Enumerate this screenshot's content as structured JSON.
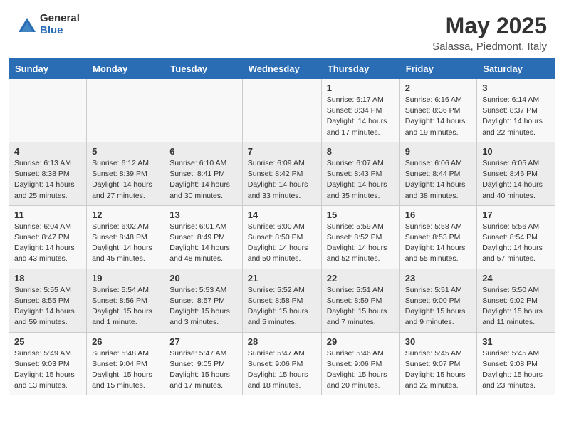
{
  "header": {
    "logo_general": "General",
    "logo_blue": "Blue",
    "month": "May 2025",
    "location": "Salassa, Piedmont, Italy"
  },
  "weekdays": [
    "Sunday",
    "Monday",
    "Tuesday",
    "Wednesday",
    "Thursday",
    "Friday",
    "Saturday"
  ],
  "weeks": [
    [
      null,
      null,
      null,
      null,
      {
        "day": "1",
        "sunrise": "6:17 AM",
        "sunset": "8:34 PM",
        "daylight": "14 hours and 17 minutes."
      },
      {
        "day": "2",
        "sunrise": "6:16 AM",
        "sunset": "8:36 PM",
        "daylight": "14 hours and 19 minutes."
      },
      {
        "day": "3",
        "sunrise": "6:14 AM",
        "sunset": "8:37 PM",
        "daylight": "14 hours and 22 minutes."
      }
    ],
    [
      {
        "day": "4",
        "sunrise": "6:13 AM",
        "sunset": "8:38 PM",
        "daylight": "14 hours and 25 minutes."
      },
      {
        "day": "5",
        "sunrise": "6:12 AM",
        "sunset": "8:39 PM",
        "daylight": "14 hours and 27 minutes."
      },
      {
        "day": "6",
        "sunrise": "6:10 AM",
        "sunset": "8:41 PM",
        "daylight": "14 hours and 30 minutes."
      },
      {
        "day": "7",
        "sunrise": "6:09 AM",
        "sunset": "8:42 PM",
        "daylight": "14 hours and 33 minutes."
      },
      {
        "day": "8",
        "sunrise": "6:07 AM",
        "sunset": "8:43 PM",
        "daylight": "14 hours and 35 minutes."
      },
      {
        "day": "9",
        "sunrise": "6:06 AM",
        "sunset": "8:44 PM",
        "daylight": "14 hours and 38 minutes."
      },
      {
        "day": "10",
        "sunrise": "6:05 AM",
        "sunset": "8:46 PM",
        "daylight": "14 hours and 40 minutes."
      }
    ],
    [
      {
        "day": "11",
        "sunrise": "6:04 AM",
        "sunset": "8:47 PM",
        "daylight": "14 hours and 43 minutes."
      },
      {
        "day": "12",
        "sunrise": "6:02 AM",
        "sunset": "8:48 PM",
        "daylight": "14 hours and 45 minutes."
      },
      {
        "day": "13",
        "sunrise": "6:01 AM",
        "sunset": "8:49 PM",
        "daylight": "14 hours and 48 minutes."
      },
      {
        "day": "14",
        "sunrise": "6:00 AM",
        "sunset": "8:50 PM",
        "daylight": "14 hours and 50 minutes."
      },
      {
        "day": "15",
        "sunrise": "5:59 AM",
        "sunset": "8:52 PM",
        "daylight": "14 hours and 52 minutes."
      },
      {
        "day": "16",
        "sunrise": "5:58 AM",
        "sunset": "8:53 PM",
        "daylight": "14 hours and 55 minutes."
      },
      {
        "day": "17",
        "sunrise": "5:56 AM",
        "sunset": "8:54 PM",
        "daylight": "14 hours and 57 minutes."
      }
    ],
    [
      {
        "day": "18",
        "sunrise": "5:55 AM",
        "sunset": "8:55 PM",
        "daylight": "14 hours and 59 minutes."
      },
      {
        "day": "19",
        "sunrise": "5:54 AM",
        "sunset": "8:56 PM",
        "daylight": "15 hours and 1 minute."
      },
      {
        "day": "20",
        "sunrise": "5:53 AM",
        "sunset": "8:57 PM",
        "daylight": "15 hours and 3 minutes."
      },
      {
        "day": "21",
        "sunrise": "5:52 AM",
        "sunset": "8:58 PM",
        "daylight": "15 hours and 5 minutes."
      },
      {
        "day": "22",
        "sunrise": "5:51 AM",
        "sunset": "8:59 PM",
        "daylight": "15 hours and 7 minutes."
      },
      {
        "day": "23",
        "sunrise": "5:51 AM",
        "sunset": "9:00 PM",
        "daylight": "15 hours and 9 minutes."
      },
      {
        "day": "24",
        "sunrise": "5:50 AM",
        "sunset": "9:02 PM",
        "daylight": "15 hours and 11 minutes."
      }
    ],
    [
      {
        "day": "25",
        "sunrise": "5:49 AM",
        "sunset": "9:03 PM",
        "daylight": "15 hours and 13 minutes."
      },
      {
        "day": "26",
        "sunrise": "5:48 AM",
        "sunset": "9:04 PM",
        "daylight": "15 hours and 15 minutes."
      },
      {
        "day": "27",
        "sunrise": "5:47 AM",
        "sunset": "9:05 PM",
        "daylight": "15 hours and 17 minutes."
      },
      {
        "day": "28",
        "sunrise": "5:47 AM",
        "sunset": "9:06 PM",
        "daylight": "15 hours and 18 minutes."
      },
      {
        "day": "29",
        "sunrise": "5:46 AM",
        "sunset": "9:06 PM",
        "daylight": "15 hours and 20 minutes."
      },
      {
        "day": "30",
        "sunrise": "5:45 AM",
        "sunset": "9:07 PM",
        "daylight": "15 hours and 22 minutes."
      },
      {
        "day": "31",
        "sunrise": "5:45 AM",
        "sunset": "9:08 PM",
        "daylight": "15 hours and 23 minutes."
      }
    ]
  ]
}
